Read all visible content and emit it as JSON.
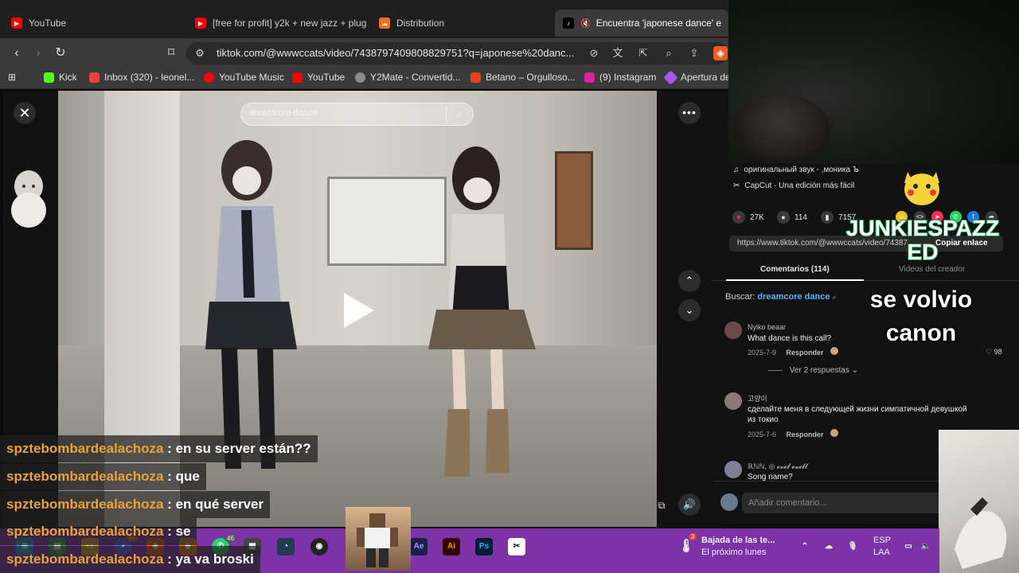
{
  "tabs": [
    {
      "label": "YouTube",
      "color": "#ff0000"
    },
    {
      "label": "[free for profit] y2k + new jazz + plug",
      "color": "#ff0000"
    },
    {
      "label": "Distribution",
      "color": "#f26f21"
    },
    {
      "label": "Encuentra 'japonese dance' e",
      "color": "#000000"
    }
  ],
  "address": {
    "url": "tiktok.com/@wwwccats/video/7438797409808829751?q=japonese%20danc..."
  },
  "bookmarks": [
    {
      "label": "Kick",
      "color": "#53fc18"
    },
    {
      "label": "Inbox (320) - leonel...",
      "color": "#ea4335"
    },
    {
      "label": "YouTube Music",
      "color": "#ff0000"
    },
    {
      "label": "YouTube",
      "color": "#ff0000"
    },
    {
      "label": "Y2Mate - Convertid...",
      "color": "#8a8a8a"
    },
    {
      "label": "Betano – Orgulloso...",
      "color": "#e8421c"
    },
    {
      "label": "(9) Instagram",
      "color": "#d6249f"
    },
    {
      "label": "Apertura de",
      "color": "#a855f7"
    }
  ],
  "video": {
    "search_text": "dreamcore dance"
  },
  "post": {
    "sound": "оригинальный звук - ,моника Ъ",
    "capcut": "CapCut · Una edición más fácil",
    "likes": "27K",
    "comments": "114",
    "saves": "7157",
    "link": "https://www.tiktok.com/@wwwccats/video/74387...",
    "copy_label": "Copiar enlace"
  },
  "comment_tabs": {
    "comments": "Comentarios (114)",
    "creator": "Videos del creador"
  },
  "buscar": {
    "label": "Buscar:",
    "query": "dreamcore dance"
  },
  "comments": [
    {
      "user": "Nyiko beaar",
      "text": "What dance is this call?",
      "date": "2025-7-9",
      "reply": "Responder",
      "likes": "98",
      "replies": "Ver 2 respuestas"
    },
    {
      "user": "고양이",
      "text": "сделайте меня в следующей жизни симпатичной девушкой из токио",
      "date": "2025-7-6",
      "reply": "Responder"
    },
    {
      "user": "ℝℕℕ, ◎ 𝓮𝓿𝓮𝓵 𝓮𝓿𝓮𝓵𝓵",
      "text": "Song name?"
    }
  ],
  "add_comment": {
    "placeholder": "Añadir comentario..."
  },
  "overlay": {
    "title": "JUNKIESPAZZ ED",
    "subtitle": "se volvio canon"
  },
  "chat": [
    {
      "user": "spztebombardealachoza",
      "msg": "en su server están??"
    },
    {
      "user": "spztebombardealachoza",
      "msg": "que"
    },
    {
      "user": "spztebombardealachoza",
      "msg": "en qué server"
    },
    {
      "user": "spztebombardealachoza",
      "msg": "se"
    },
    {
      "user": "spztebombardealachoza",
      "msg": "ya va broski"
    }
  ],
  "taskbar": {
    "weather_title": "Bajada de las te...",
    "weather_sub": "El próximo lunes",
    "weather_badge": "3",
    "lang_top": "ESP",
    "lang_bottom": "LAA",
    "badge_46": "46",
    "badge_9plus": "9+"
  }
}
